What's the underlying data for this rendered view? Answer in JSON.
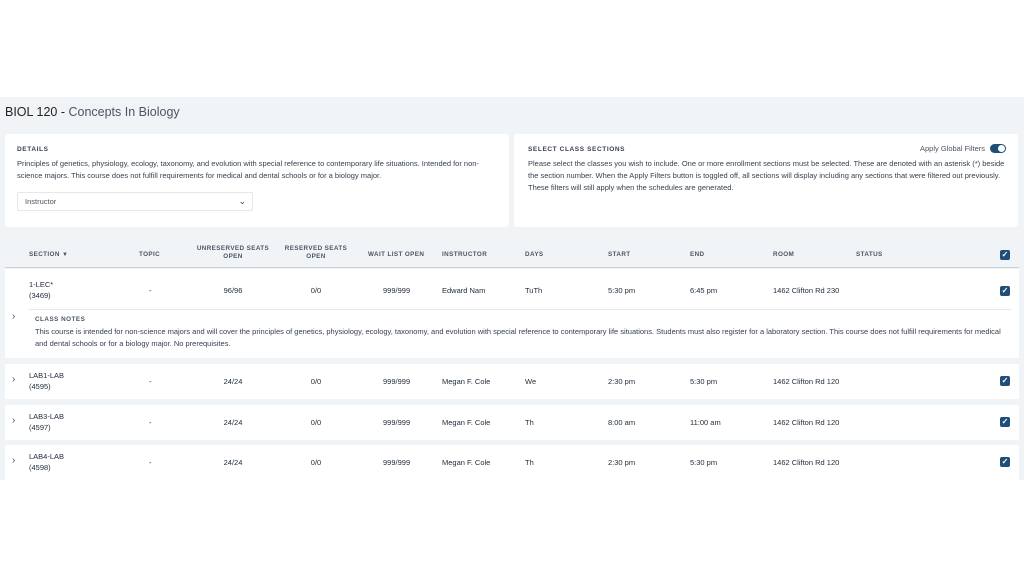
{
  "course": {
    "code": "BIOL 120",
    "separator": " - ",
    "name": "Concepts In Biology"
  },
  "details": {
    "label": "DETAILS",
    "description": "Principles of genetics, physiology, ecology, taxonomy, and evolution with special reference to contemporary life situations. Intended for non-science majors. This course does not fulfill requirements for medical and dental schools or for a biology major.",
    "instructor_select": {
      "value": "Instructor",
      "icon": "chevron-down-icon"
    }
  },
  "select_sections": {
    "label": "SELECT CLASS SECTIONS",
    "toggle_label": "Apply Global Filters",
    "toggle_on": true,
    "description": "Please select the classes you wish to include. One or more enrollment sections must be selected. These are denoted with an asterisk (*) beside the section number. When the Apply Filters button is toggled off, all sections will display including any sections that were filtered out previously. These filters will still apply when the schedules are generated."
  },
  "table": {
    "headers": {
      "section": "SECTION",
      "topic": "TOPIC",
      "unreserved_1": "UNRESERVED SEATS",
      "unreserved_2": "OPEN",
      "reserved_1": "RESERVED SEATS",
      "reserved_2": "OPEN",
      "waitlist": "WAIT LIST OPEN",
      "instructor": "INSTRUCTOR",
      "days": "DAYS",
      "start": "START",
      "end": "END",
      "room": "ROOM",
      "status": "STATUS"
    },
    "header_checkbox_checked": true,
    "rows": [
      {
        "section": "1-LEC*",
        "id": "(3469)",
        "topic": "-",
        "unreserved": "96/96",
        "reserved": "0/0",
        "waitlist": "999/999",
        "instructor": "Edward Nam",
        "days": "TuTh",
        "start": "5:30 pm",
        "end": "6:45 pm",
        "room": "1462 Clifton Rd 230",
        "status": "",
        "checked": true,
        "notes_label": "CLASS NOTES",
        "notes": "This course is intended for non-science majors and will cover the principles of genetics, physiology, ecology, taxonomy, and evolution with special reference to contemporary life situations. Students must also register for a laboratory section. This course does not fulfill requirements for medical and dental schools or for a biology major. No prerequisites."
      },
      {
        "section": "LAB1-LAB",
        "id": "(4595)",
        "topic": "-",
        "unreserved": "24/24",
        "reserved": "0/0",
        "waitlist": "999/999",
        "instructor": "Megan F. Cole",
        "days": "We",
        "start": "2:30 pm",
        "end": "5:30 pm",
        "room": "1462 Clifton Rd 120",
        "status": "",
        "checked": true
      },
      {
        "section": "LAB3-LAB",
        "id": "(4597)",
        "topic": "-",
        "unreserved": "24/24",
        "reserved": "0/0",
        "waitlist": "999/999",
        "instructor": "Megan F. Cole",
        "days": "Th",
        "start": "8:00 am",
        "end": "11:00 am",
        "room": "1462 Clifton Rd 120",
        "status": "",
        "checked": true
      },
      {
        "section": "LAB4-LAB",
        "id": "(4598)",
        "topic": "-",
        "unreserved": "24/24",
        "reserved": "0/0",
        "waitlist": "999/999",
        "instructor": "Megan F. Cole",
        "days": "Th",
        "start": "2:30 pm",
        "end": "5:30 pm",
        "room": "1462 Clifton Rd 120",
        "status": "",
        "checked": true
      }
    ]
  },
  "colors": {
    "accent": "#1f4e79",
    "background": "#f1f4f7",
    "panel": "#ffffff"
  }
}
